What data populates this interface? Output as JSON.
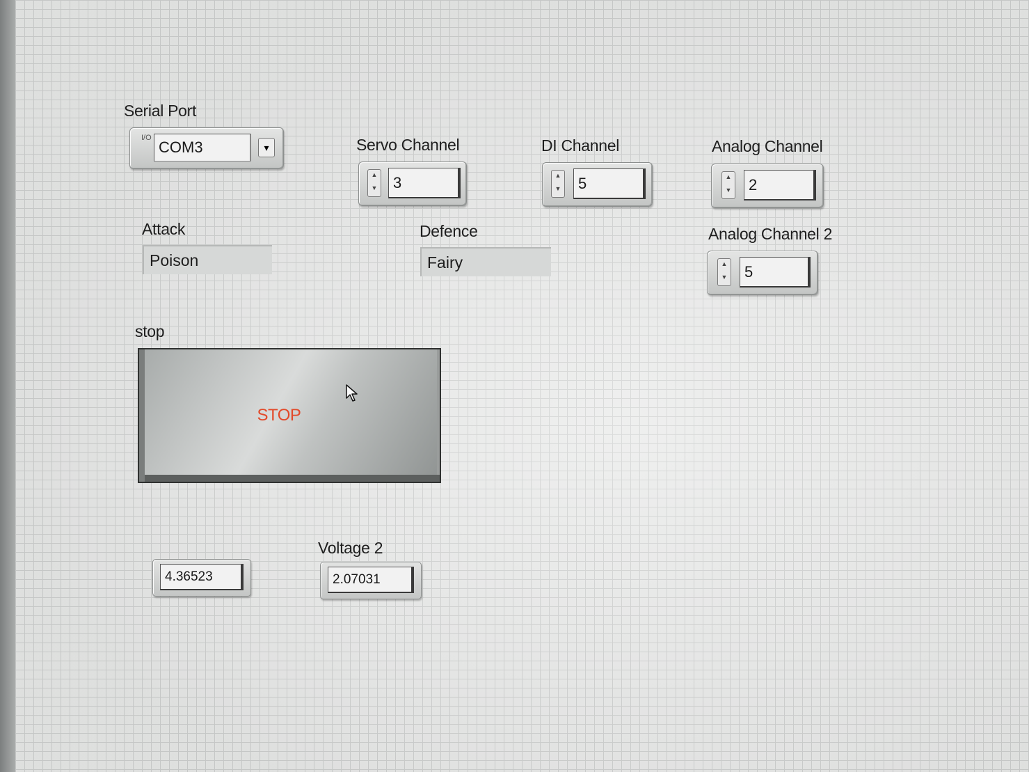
{
  "serial_port": {
    "label": "Serial Port",
    "value": "COM3",
    "io_icon_glyph": "I/O"
  },
  "servo_channel": {
    "label": "Servo Channel",
    "value": "3"
  },
  "di_channel": {
    "label": "DI Channel",
    "value": "5"
  },
  "analog_channel": {
    "label": "Analog Channel",
    "value": "2"
  },
  "analog_channel_2": {
    "label": "Analog Channel 2",
    "value": "5"
  },
  "attack": {
    "label": "Attack",
    "value": "Poison"
  },
  "defence": {
    "label": "Defence",
    "value": "Fairy"
  },
  "stop": {
    "label": "stop",
    "button_text": "STOP",
    "button_text_color": "#e24a2a"
  },
  "voltage_1": {
    "value": "4.36523"
  },
  "voltage_2": {
    "label": "Voltage 2",
    "value": "2.07031"
  },
  "icons": {
    "spin_up": "▲",
    "spin_down": "▼",
    "dropdown": "▾"
  }
}
